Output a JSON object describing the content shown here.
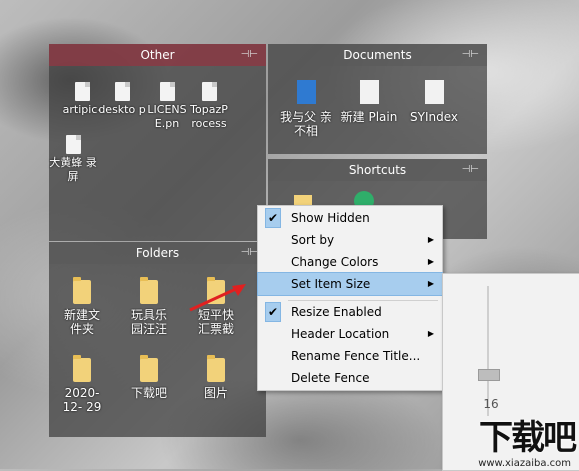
{
  "fences": {
    "other": {
      "title": "Other",
      "items": [
        "artipic-app...",
        "deskto p",
        "LICENS E.pn",
        "TopazP rocess",
        "大黄蜂 录屏"
      ]
    },
    "documents": {
      "title": "Documents",
      "items": [
        "我与父 亲不相",
        "新建 Plain",
        "SYIndex"
      ]
    },
    "shortcuts": {
      "title": "Shortcuts"
    },
    "folders": {
      "title": "Folders",
      "items": [
        "新建文 件夹",
        "玩具乐 园汪汪",
        "短平快 汇票截",
        "2020-12- 29",
        "下载吧",
        "图片"
      ]
    }
  },
  "pin_glyph": "⊣⊢",
  "context_menu": {
    "items": [
      {
        "label": "Show Hidden",
        "checked": true,
        "submenu": false
      },
      {
        "label": "Sort by",
        "checked": false,
        "submenu": true
      },
      {
        "label": "Change Colors",
        "checked": false,
        "submenu": true
      },
      {
        "label": "Set Item Size",
        "checked": false,
        "submenu": true,
        "highlighted": true
      },
      {
        "label": "Resize Enabled",
        "checked": true,
        "submenu": false
      },
      {
        "label": "Header Location",
        "checked": false,
        "submenu": true
      },
      {
        "label": "Rename Fence Title...",
        "checked": false,
        "submenu": false
      },
      {
        "label": "Delete Fence",
        "checked": false,
        "submenu": false
      }
    ],
    "check_glyph": "✔",
    "arrow_glyph": "▶"
  },
  "item_size_slider": {
    "value": "16"
  },
  "watermark": {
    "text": "下载吧",
    "url": "www.xiazaiba.com"
  },
  "colors": {
    "other_header": "#8a3a44",
    "menu_highlight": "#a7cdee"
  }
}
